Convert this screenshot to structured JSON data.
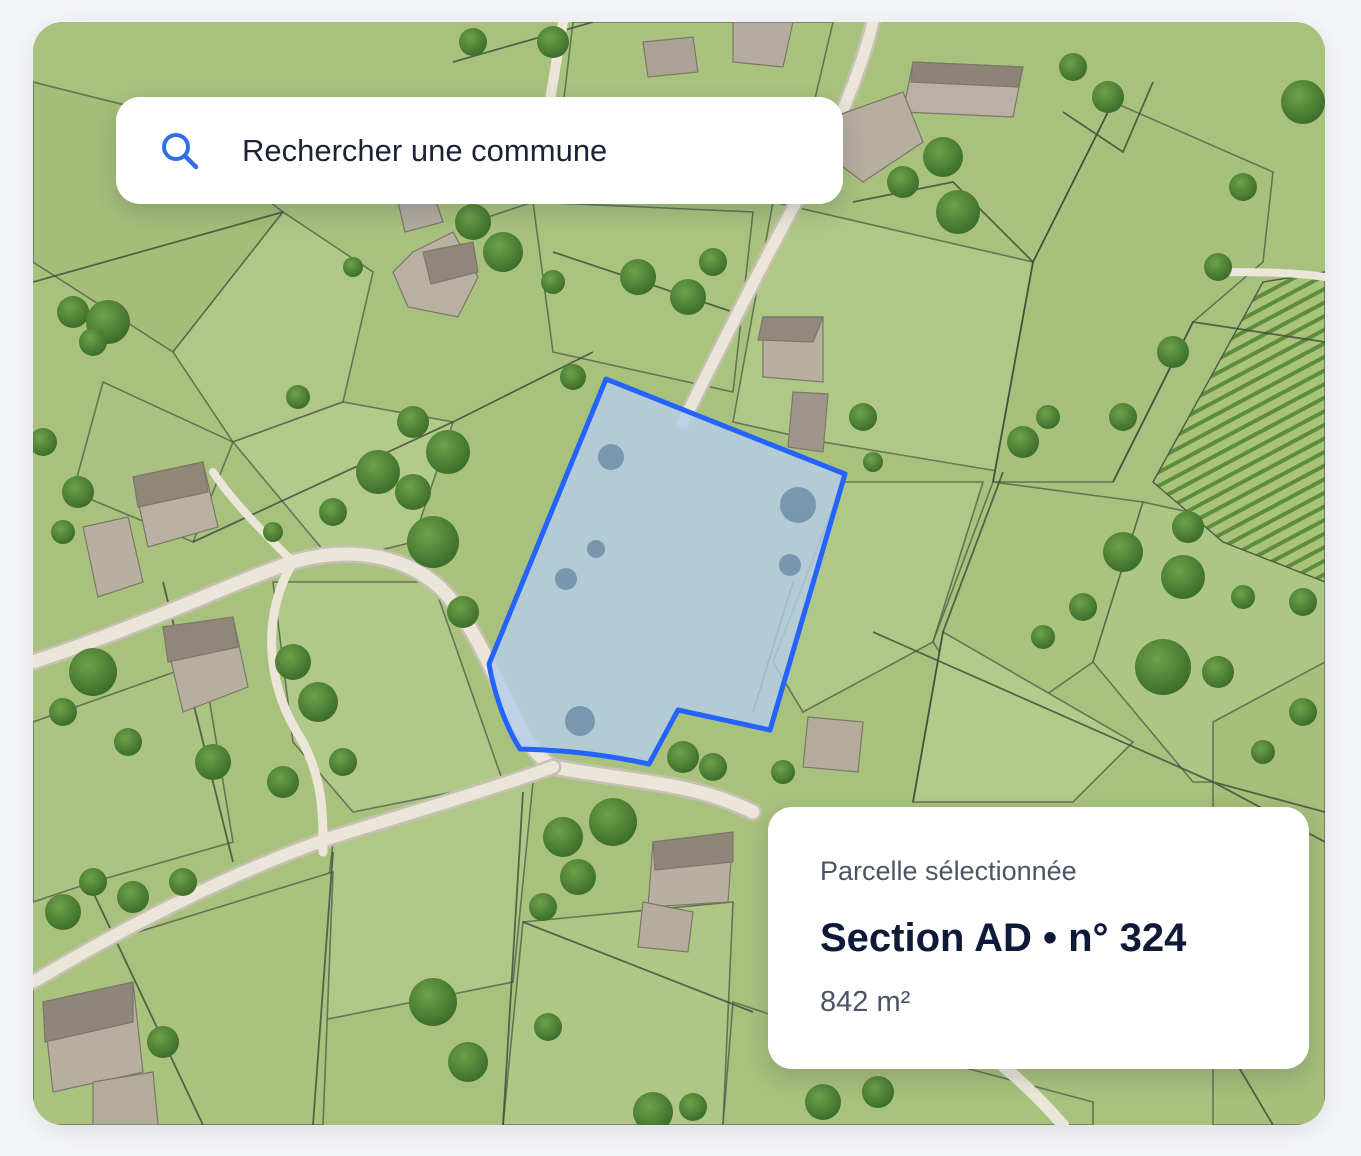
{
  "search": {
    "placeholder": "Rechercher une commune",
    "icon": "search-icon",
    "accent_color": "#2f6fe6"
  },
  "selected_parcel": {
    "label": "Parcelle sélectionnée",
    "title": "Section AD • n° 324",
    "area": "842 m²",
    "outline_color": "#2563ff",
    "fill_color": "#b4cde8"
  },
  "map": {
    "style": "aerial",
    "land_color": "#a8c27e",
    "road_color": "#e9e4d6",
    "building_color": "#b7b0a2"
  }
}
